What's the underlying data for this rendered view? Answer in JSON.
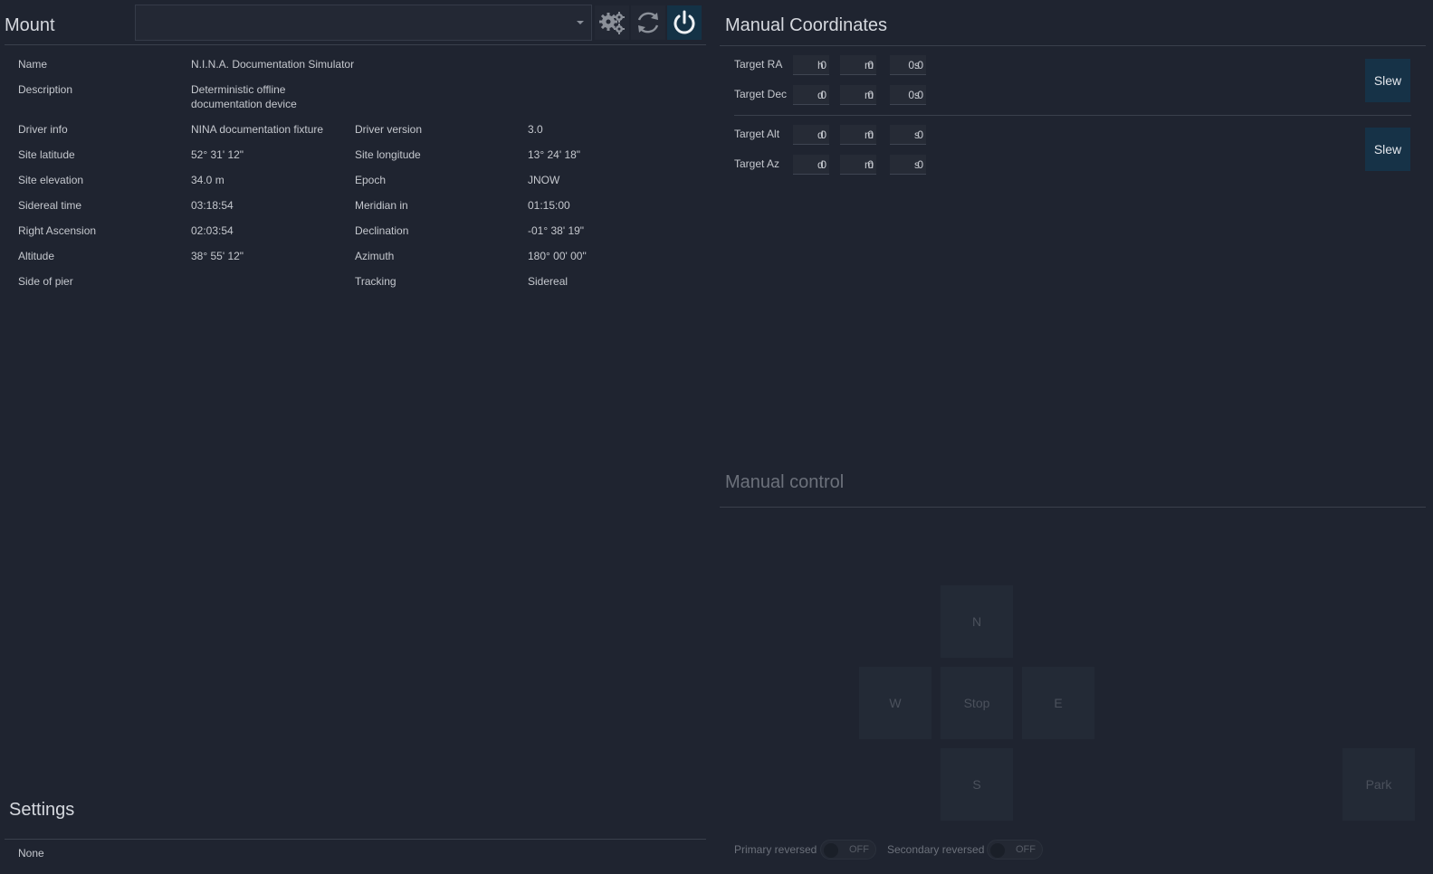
{
  "mount": {
    "title": "Mount",
    "device_select_value": "",
    "icons": {
      "settings": "gears-icon",
      "refresh": "refresh-icon",
      "power": "power-icon"
    },
    "accent_color": "#143246",
    "info": {
      "name_label": "Name",
      "name_value": "N.I.N.A. Documentation Simulator",
      "description_label": "Description",
      "description_value_line1": "Deterministic offline",
      "description_value_line2": "documentation device",
      "driver_info_label": "Driver info",
      "driver_info_value": "NINA documentation fixture",
      "driver_version_label": "Driver version",
      "driver_version_value": "3.0",
      "site_latitude_label": "Site latitude",
      "site_latitude_value": "52° 31' 12\"",
      "site_longitude_label": "Site longitude",
      "site_longitude_value": "13° 24' 18\"",
      "site_elevation_label": "Site elevation",
      "site_elevation_value": "34.0 m",
      "epoch_label": "Epoch",
      "epoch_value": "JNOW",
      "sidereal_time_label": "Sidereal time",
      "sidereal_time_value": "03:18:54",
      "meridian_in_label": "Meridian in",
      "meridian_in_value": "01:15:00",
      "right_ascension_label": "Right Ascension",
      "right_ascension_value": "02:03:54",
      "declination_label": "Declination",
      "declination_value": "-01° 38' 19\"",
      "altitude_label": "Altitude",
      "altitude_value": "38° 55' 12\"",
      "azimuth_label": "Azimuth",
      "azimuth_value": "180° 00' 00\"",
      "side_of_pier_label": "Side of pier",
      "side_of_pier_value": "",
      "tracking_label": "Tracking",
      "tracking_value": "Sidereal"
    }
  },
  "settings": {
    "title": "Settings",
    "value": "None"
  },
  "manual_coordinates": {
    "title": "Manual Coordinates",
    "target_ra": {
      "label": "Target RA",
      "h": "0",
      "h_unit": "h",
      "m": "0",
      "m_unit": "m",
      "s": "0.0",
      "s_unit": "s"
    },
    "target_dec": {
      "label": "Target Dec",
      "d": "0",
      "d_unit": "d",
      "m": "0",
      "m_unit": "m",
      "s": "0.0",
      "s_unit": "s"
    },
    "target_alt": {
      "label": "Target Alt",
      "d": "0",
      "d_unit": "d",
      "m": "0",
      "m_unit": "m",
      "s": "0",
      "s_unit": "s"
    },
    "target_az": {
      "label": "Target Az",
      "d": "0",
      "d_unit": "d",
      "m": "0",
      "m_unit": "m",
      "s": "0",
      "s_unit": "s"
    },
    "slew_label": "Slew"
  },
  "manual_control": {
    "title": "Manual control",
    "north": "N",
    "west": "W",
    "stop": "Stop",
    "east": "E",
    "south": "S",
    "park": "Park",
    "primary_reversed_label": "Primary reversed",
    "primary_reversed_state": "OFF",
    "secondary_reversed_label": "Secondary reversed",
    "secondary_reversed_state": "OFF"
  }
}
